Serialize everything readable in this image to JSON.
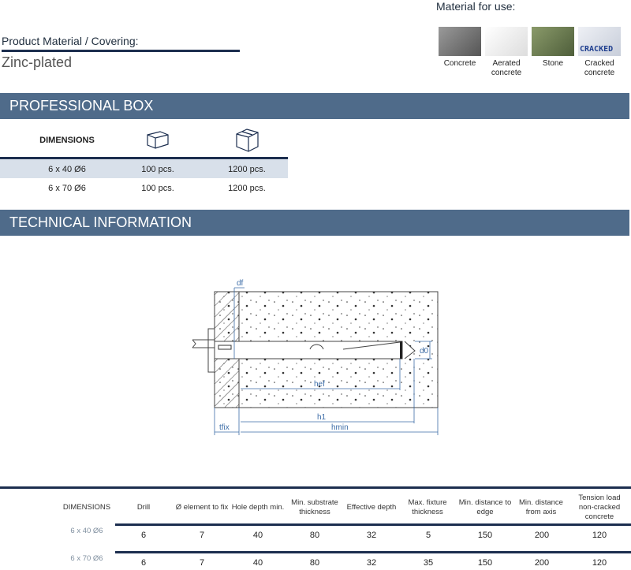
{
  "material_for_use": {
    "title": "Material for use:",
    "items": [
      {
        "label": "Concrete",
        "color": "#6a6a6a"
      },
      {
        "label": "Aerated concrete",
        "color": "#eeeeea"
      },
      {
        "label": "Stone",
        "color": "#6f7f5a"
      },
      {
        "label": "Cracked concrete",
        "color": "#d8dde6",
        "overlay": "CRACKED"
      }
    ]
  },
  "product": {
    "label": "Product Material / Covering:",
    "value": "Zinc-plated"
  },
  "professional_box": {
    "title": "PROFESSIONAL BOX",
    "header": "DIMENSIONS",
    "rows": [
      [
        "6 x 40 Ø6",
        "100 pcs.",
        "1200 pcs."
      ],
      [
        "6 x 70 Ø6",
        "100 pcs.",
        "1200 pcs."
      ]
    ]
  },
  "technical": {
    "title": "TECHNICAL INFORMATION",
    "diagram_labels": {
      "df": "df",
      "d0": "d0",
      "hef": "hef",
      "h1": "h1",
      "hmin": "hmin",
      "tfix": "tfix"
    }
  },
  "tech_table": {
    "headers": [
      "DIMENSIONS",
      "Drill",
      "Ø element to fix",
      "Hole depth min.",
      "Min. substrate thickness",
      "Effective depth",
      "Max. fixture thickness",
      "Min. distance to edge",
      "Min. distance from axis",
      "Tension load non-cracked concrete"
    ],
    "rows": [
      [
        "6 x 40 Ø6",
        "6",
        "7",
        "40",
        "80",
        "32",
        "5",
        "150",
        "200",
        "120"
      ],
      [
        "6 x 70 Ø6",
        "6",
        "7",
        "40",
        "80",
        "32",
        "35",
        "150",
        "200",
        "120"
      ]
    ]
  },
  "colors": {
    "accent": "#4f6b8a",
    "navy": "#1c2e4f",
    "row_highlight": "#d8e0ea"
  }
}
